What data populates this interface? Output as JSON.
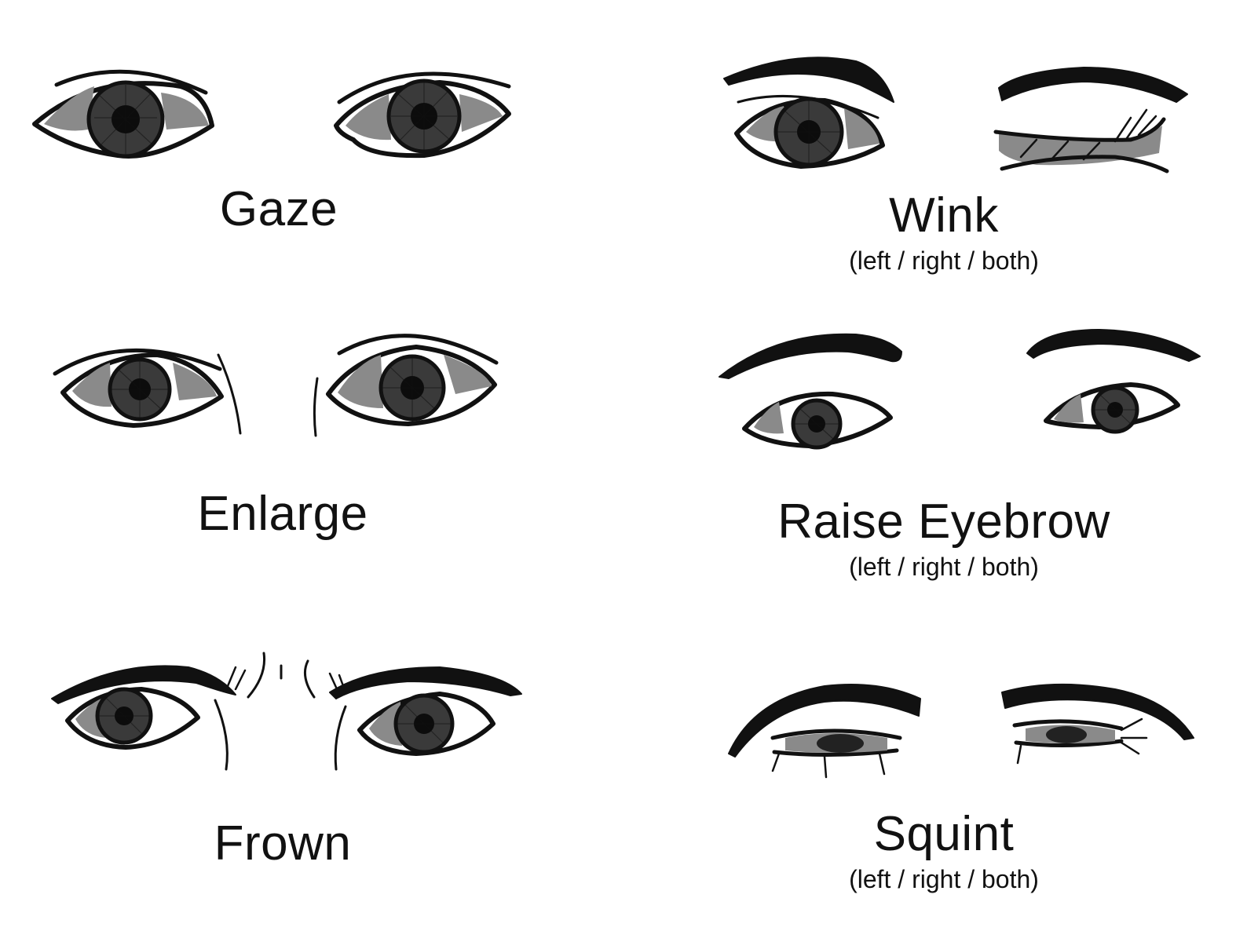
{
  "items": [
    {
      "key": "gaze",
      "label": "Gaze",
      "sub": ""
    },
    {
      "key": "wink",
      "label": "Wink",
      "sub": "(left / right / both)"
    },
    {
      "key": "enlarge",
      "label": "Enlarge",
      "sub": ""
    },
    {
      "key": "raise",
      "label": "Raise Eyebrow",
      "sub": "(left / right / both)"
    },
    {
      "key": "frown",
      "label": "Frown",
      "sub": ""
    },
    {
      "key": "squint",
      "label": "Squint",
      "sub": "(left / right / both)"
    }
  ],
  "colors": {
    "ink": "#111111",
    "shade": "#8a8a8a",
    "paper": "#ffffff"
  }
}
